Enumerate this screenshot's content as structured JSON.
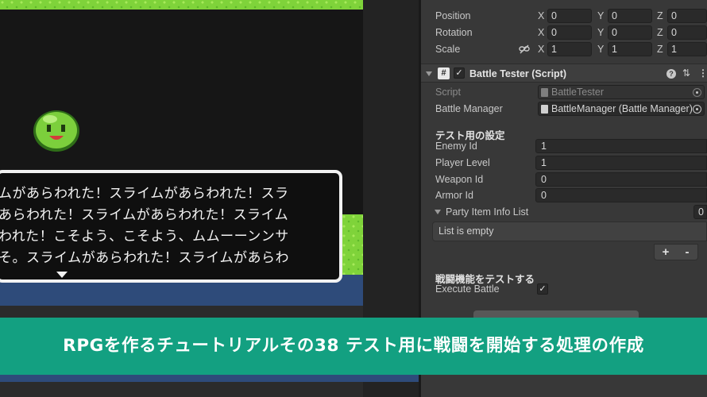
{
  "game": {
    "message_lines": [
      "ムがあらわれた！スライムがあらわれた！スラ",
      "あらわれた！スライムがあらわれた！スライム",
      "われた！こそよう、こそよう、ムムーーンンサ",
      "そ。スライムがあらわれた！スライムがあらわ"
    ]
  },
  "transform": {
    "rows": [
      {
        "label": "Position",
        "x": "0",
        "y": "0",
        "z": "0"
      },
      {
        "label": "Rotation",
        "x": "0",
        "y": "0",
        "z": "0"
      },
      {
        "label": "Scale",
        "x": "1",
        "y": "1",
        "z": "1"
      }
    ],
    "axis": {
      "x": "X",
      "y": "Y",
      "z": "Z"
    }
  },
  "component": {
    "icon": "#",
    "enabled": "✓",
    "title": "Battle Tester (Script)",
    "help_icon": "?",
    "settings_icon": "⇅",
    "menu_icon": "⋮",
    "script_label": "Script",
    "script_value": "BattleTester",
    "battle_manager_label": "Battle Manager",
    "battle_manager_value": "BattleManager (Battle Manager)",
    "test_section": "テスト用の設定",
    "fields": [
      {
        "label": "Enemy Id",
        "value": "1"
      },
      {
        "label": "Player Level",
        "value": "1"
      },
      {
        "label": "Weapon Id",
        "value": "0"
      },
      {
        "label": "Armor Id",
        "value": "0"
      }
    ],
    "party_list_label": "Party Item Info List",
    "party_list_count": "0",
    "list_empty": "List is empty",
    "add_label": "+",
    "remove_label": "-",
    "battle_section": "戦闘機能をテストする",
    "execute_label": "Execute Battle",
    "execute_checked": "✓"
  },
  "banner": {
    "text": "RPGを作るチュートリアルその38 テスト用に戦闘を開始する処理の作成"
  },
  "colors": {
    "banner": "#13a081",
    "grass": "#7fd33a",
    "water": "#2e4b7a",
    "slime": "#7ccf3c"
  }
}
